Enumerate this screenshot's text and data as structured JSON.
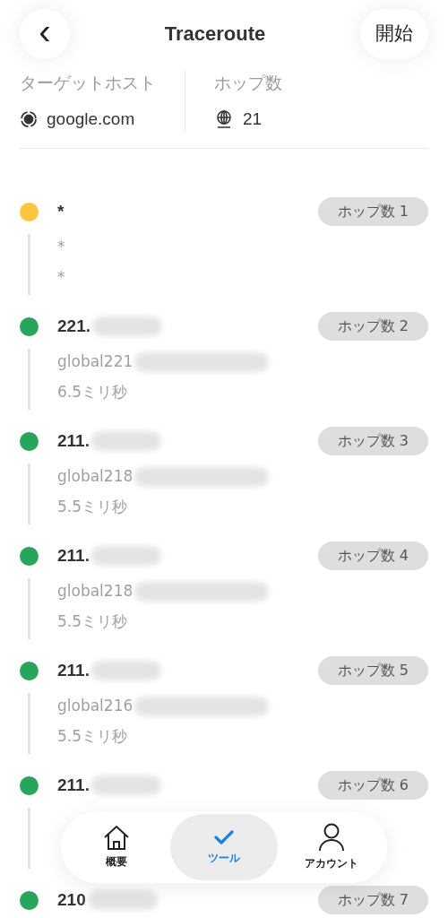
{
  "header": {
    "back": "‹",
    "title": "Traceroute",
    "start": "開始"
  },
  "summary": [
    {
      "label": "ターゲットホスト",
      "value": "google.com",
      "kind": "host"
    },
    {
      "label": "ホップ数",
      "value": "21",
      "kind": "count"
    }
  ],
  "hops": [
    {
      "address": "*",
      "redacted": false,
      "color": "#fcc73f",
      "badge": "ホップ数 1",
      "lines": [
        {
          "text": "*",
          "redacted": false
        },
        {
          "text": "*",
          "redacted": false
        }
      ]
    },
    {
      "address": "221.",
      "redacted": true,
      "color": "#27a55a",
      "badge": "ホップ数 2",
      "lines": [
        {
          "text": "global221",
          "redacted": true
        },
        {
          "text": "6.5ミリ秒",
          "redacted": false
        }
      ]
    },
    {
      "address": "211.",
      "redacted": true,
      "color": "#27a55a",
      "badge": "ホップ数 3",
      "lines": [
        {
          "text": "global218",
          "redacted": true
        },
        {
          "text": "5.5ミリ秒",
          "redacted": false
        }
      ]
    },
    {
      "address": "211.",
      "redacted": true,
      "color": "#27a55a",
      "badge": "ホップ数 4",
      "lines": [
        {
          "text": "global218",
          "redacted": true
        },
        {
          "text": "5.5ミリ秒",
          "redacted": false
        }
      ]
    },
    {
      "address": "211.",
      "redacted": true,
      "color": "#27a55a",
      "badge": "ホップ数 5",
      "lines": [
        {
          "text": "global216",
          "redacted": true
        },
        {
          "text": "5.5ミリ秒",
          "redacted": false
        }
      ]
    },
    {
      "address": "211.",
      "redacted": true,
      "color": "#27a55a",
      "badge": "ホップ数 6"
    },
    {
      "address": "210",
      "redacted": true,
      "color": "#27a55a",
      "badge": "ホップ数 7"
    }
  ],
  "tab_bar": [
    {
      "label": "概要",
      "kind": "home",
      "selected": false
    },
    {
      "label": "ツール",
      "kind": "check",
      "selected": true
    },
    {
      "label": "アカウント",
      "kind": "person",
      "selected": false
    }
  ]
}
